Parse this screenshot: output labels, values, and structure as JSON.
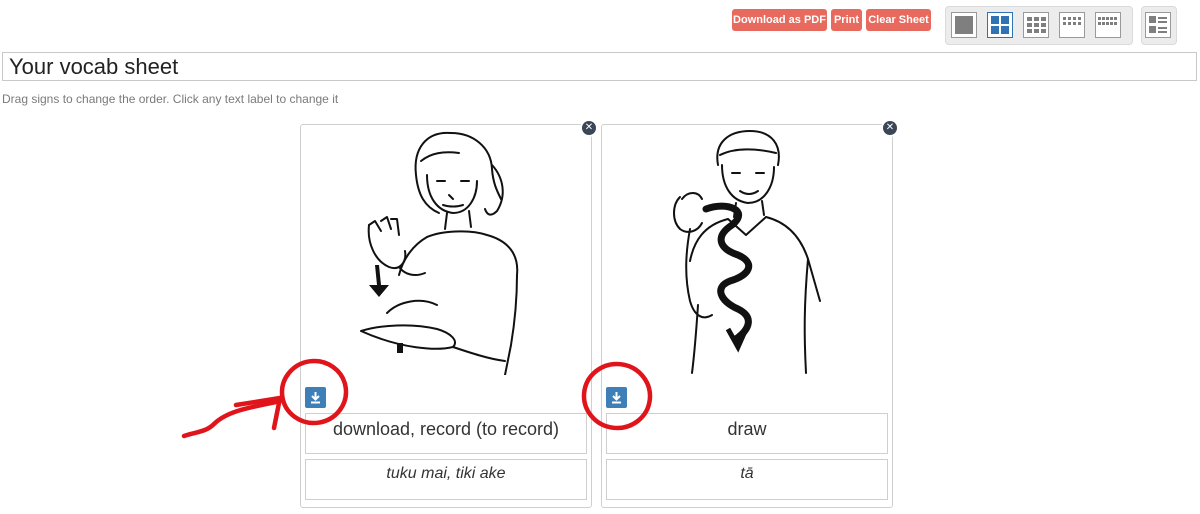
{
  "toolbar": {
    "download_pdf_label": "Download as PDF",
    "print_label": "Print",
    "clear_sheet_label": "Clear Sheet",
    "accent_color": "#e8695d"
  },
  "layouts": {
    "options": [
      "layout-1-up",
      "layout-4-up",
      "layout-6-up",
      "layout-8-up",
      "layout-12-up"
    ],
    "selected": "layout-4-up",
    "list_view": "layout-list"
  },
  "sheet": {
    "title": "Your vocab sheet",
    "hint": "Drag signs to change the order. Click any text label to change it"
  },
  "cards": [
    {
      "english": "download, record (to record)",
      "maori": "tuku mai, tiki ake",
      "illustration": "woman-signing-download"
    },
    {
      "english": "draw",
      "maori": "tā",
      "illustration": "man-signing-draw"
    }
  ],
  "annotation_color": "#e0141b"
}
